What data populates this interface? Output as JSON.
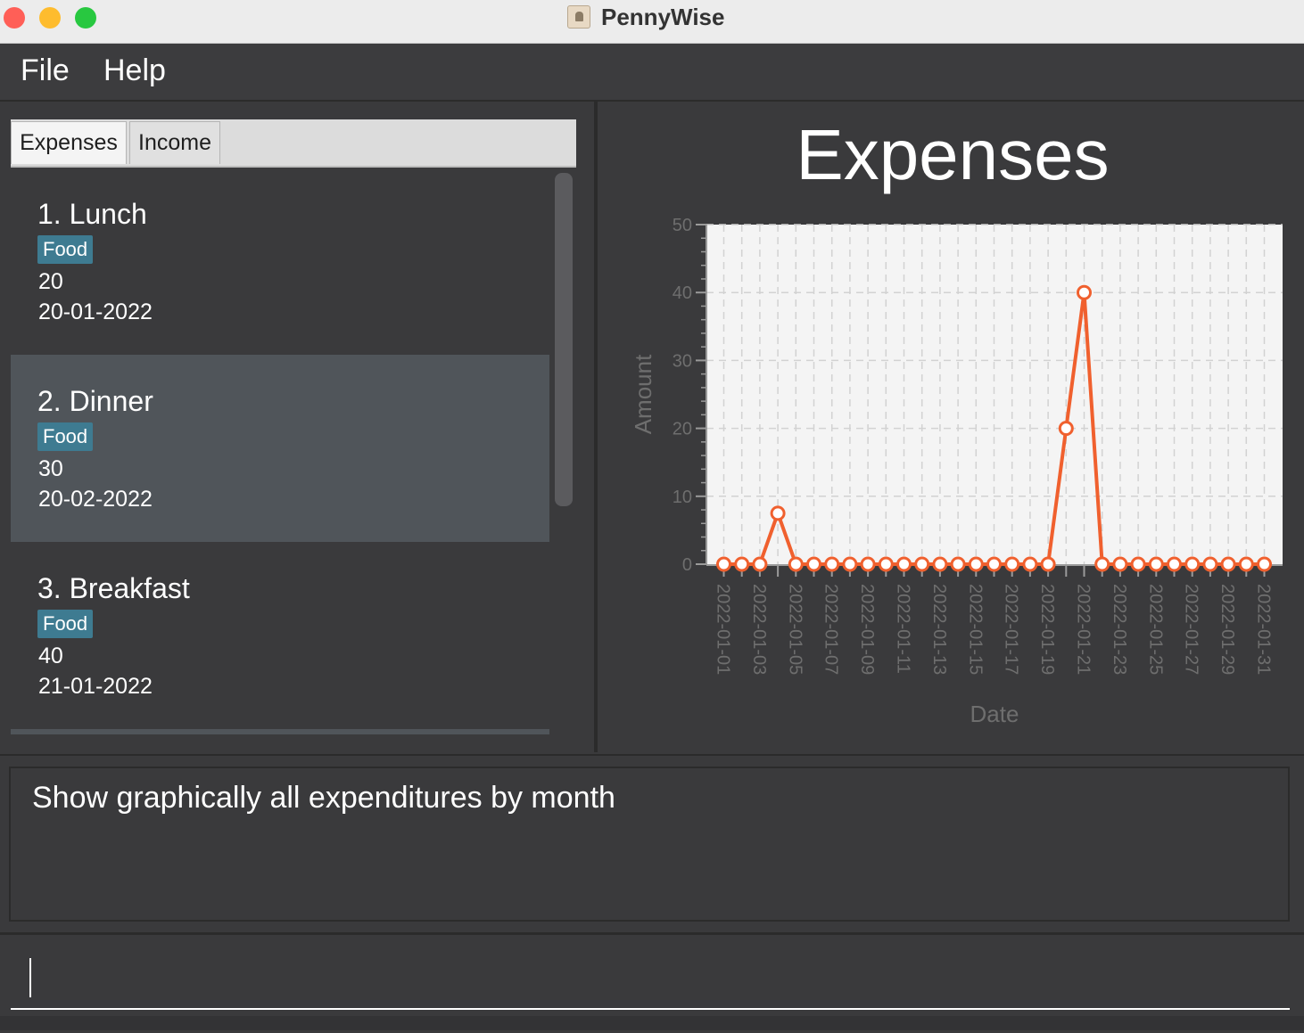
{
  "window": {
    "title": "PennyWise"
  },
  "menu": {
    "file": "File",
    "help": "Help"
  },
  "tabs": [
    {
      "label": "Expenses"
    },
    {
      "label": "Income"
    }
  ],
  "entries": [
    {
      "index_title": "1.  Lunch",
      "tag": "Food",
      "amount": "20",
      "date": "20-01-2022"
    },
    {
      "index_title": "2.  Dinner",
      "tag": "Food",
      "amount": "30",
      "date": "20-02-2022"
    },
    {
      "index_title": "3.  Breakfast",
      "tag": "Food",
      "amount": "40",
      "date": "21-01-2022"
    }
  ],
  "result": {
    "text": "Show graphically all expenditures by month"
  },
  "command": {
    "value": ""
  },
  "colors": {
    "series": "#f0602e",
    "plot_bg": "#f4f4f4"
  },
  "chart_data": {
    "type": "line",
    "title": "Expenses",
    "xlabel": "Date",
    "ylabel": "Amount",
    "ylim": [
      0,
      50
    ],
    "y_ticks": [
      "0",
      "10",
      "20",
      "30",
      "40",
      "50"
    ],
    "grid": true,
    "x": [
      "2022-01-01",
      "2022-01-02",
      "2022-01-03",
      "2022-01-04",
      "2022-01-05",
      "2022-01-06",
      "2022-01-07",
      "2022-01-08",
      "2022-01-09",
      "2022-01-10",
      "2022-01-11",
      "2022-01-12",
      "2022-01-13",
      "2022-01-14",
      "2022-01-15",
      "2022-01-16",
      "2022-01-17",
      "2022-01-18",
      "2022-01-19",
      "2022-01-20",
      "2022-01-21",
      "2022-01-22",
      "2022-01-23",
      "2022-01-24",
      "2022-01-25",
      "2022-01-26",
      "2022-01-27",
      "2022-01-28",
      "2022-01-29",
      "2022-01-30",
      "2022-01-31"
    ],
    "x_tick_labels": [
      "2022-01-01",
      "2022-01-03",
      "2022-01-05",
      "2022-01-07",
      "2022-01-09",
      "2022-01-11",
      "2022-01-13",
      "2022-01-15",
      "2022-01-17",
      "2022-01-19",
      "2022-01-21",
      "2022-01-23",
      "2022-01-25",
      "2022-01-27",
      "2022-01-29",
      "2022-01-31"
    ],
    "values": [
      0,
      0,
      0,
      7.5,
      0,
      0,
      0,
      0,
      0,
      0,
      0,
      0,
      0,
      0,
      0,
      0,
      0,
      0,
      0,
      20,
      40,
      0,
      0,
      0,
      0,
      0,
      0,
      0,
      0,
      0,
      0
    ]
  }
}
